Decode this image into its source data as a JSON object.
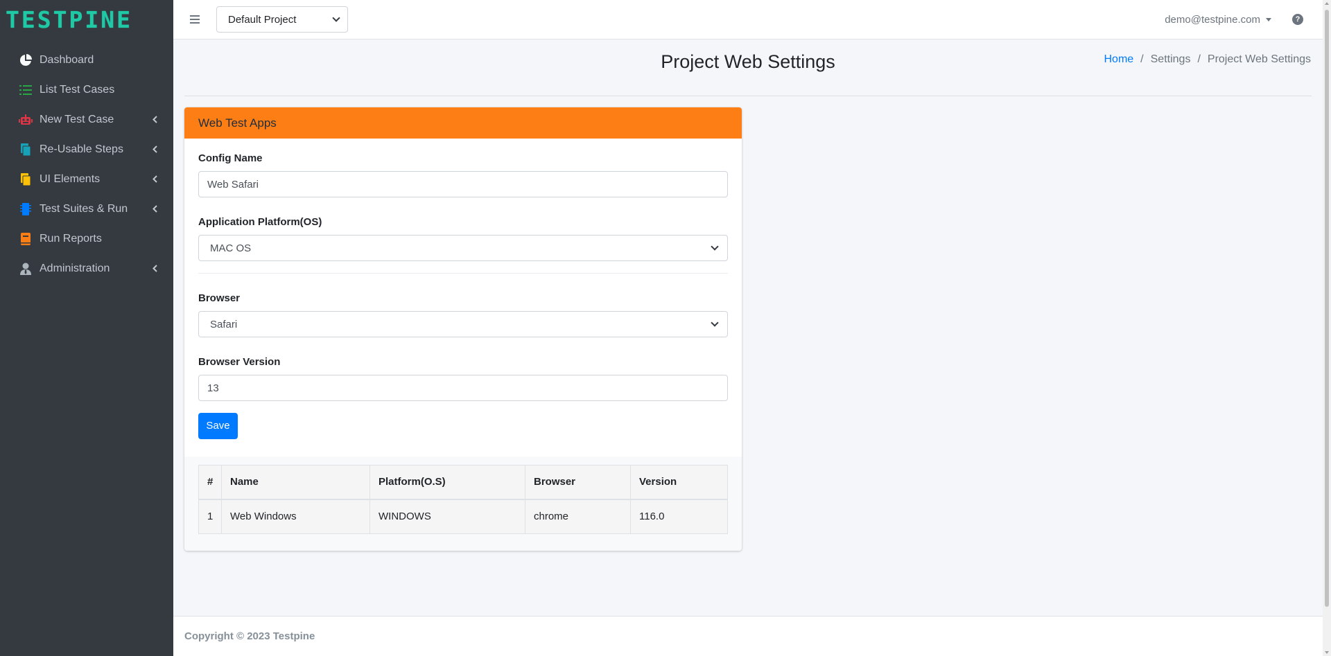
{
  "brand": {
    "name": "TESTPINE",
    "color": "#20c9a6"
  },
  "sidebar": {
    "items": [
      {
        "label": "Dashboard",
        "icon": "pie-chart-icon",
        "has_submenu": false
      },
      {
        "label": "List Test Cases",
        "icon": "list-icon",
        "has_submenu": false
      },
      {
        "label": "New Test Case",
        "icon": "robot-icon",
        "has_submenu": true
      },
      {
        "label": "Re-Usable Steps",
        "icon": "copy-icon",
        "has_submenu": true
      },
      {
        "label": "UI Elements",
        "icon": "files-icon",
        "has_submenu": true
      },
      {
        "label": "Test Suites & Run",
        "icon": "microchip-icon",
        "has_submenu": true
      },
      {
        "label": "Run Reports",
        "icon": "book-icon",
        "has_submenu": false
      },
      {
        "label": "Administration",
        "icon": "user-tie-icon",
        "has_submenu": true
      }
    ]
  },
  "topbar": {
    "project_select": "Default Project",
    "user_email": "demo@testpine.com"
  },
  "page": {
    "title": "Project Web Settings",
    "breadcrumb": [
      "Home",
      "Settings",
      "Project Web Settings"
    ]
  },
  "card": {
    "header": "Web Test Apps",
    "header_color": "#fd7e14",
    "config_name_label": "Config Name",
    "config_name_value": "Web Safari",
    "platform_label": "Application Platform(OS)",
    "platform_value": "MAC OS",
    "browser_label": "Browser",
    "browser_value": "Safari",
    "version_label": "Browser Version",
    "version_value": "13",
    "save_label": "Save"
  },
  "table": {
    "headers": [
      "#",
      "Name",
      "Platform(O.S)",
      "Browser",
      "Version"
    ],
    "rows": [
      [
        "1",
        "Web Windows",
        "WINDOWS",
        "chrome",
        "116.0"
      ]
    ]
  },
  "footer": {
    "copyright": "Copyright © 2023 Testpine"
  }
}
